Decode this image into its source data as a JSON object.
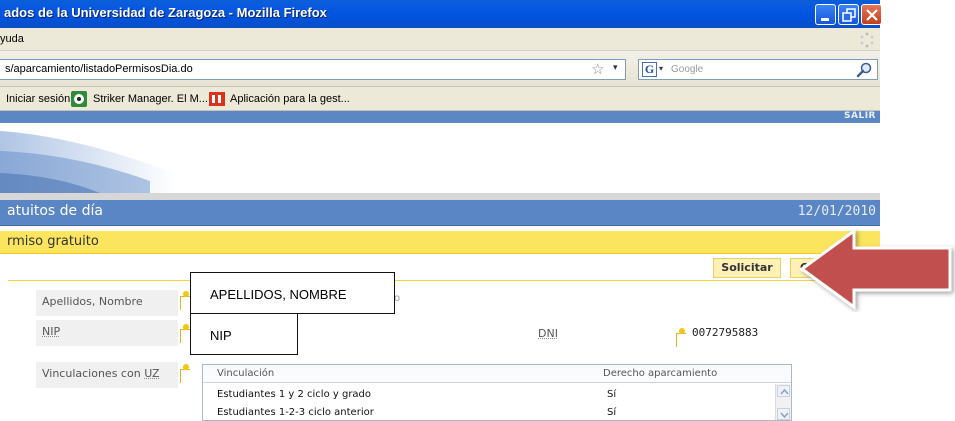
{
  "browser": {
    "window_title": "ados de la Universidad de Zaragoza - Mozilla Firefox",
    "menu_label": "yuda",
    "url": "s/aparcamiento/listadoPermisosDia.do",
    "search_engine": "G",
    "search_placeholder": "Google",
    "bookmarks": [
      {
        "label": "Iniciar sesión",
        "icon": "none"
      },
      {
        "label": "Striker Manager. El M...",
        "icon": "soccer-ball-icon"
      },
      {
        "label": "Aplicación para la gest...",
        "icon": "app-logo-icon"
      }
    ]
  },
  "header": {
    "logout_label": "SALIR"
  },
  "page": {
    "title": "atuitos de día",
    "date": "12/01/2010",
    "section_title": "rmiso gratuito"
  },
  "actions": {
    "solicitar_label": "Solicitar",
    "cancelar_label": "Ca"
  },
  "form": {
    "name_label": "Apellidos, Nombre",
    "name_overlay": "APELLIDOS, NOMBRE",
    "name_value_fragment": "o",
    "nip_label": "NIP",
    "nip_overlay": "NIP",
    "dni_label": "DNI",
    "dni_value": "0072795883",
    "vinculaciones_label_prefix": "Vinculaciones con ",
    "vinculaciones_label_abbr": "UZ"
  },
  "vinculaciones_table": {
    "columns": [
      "Vinculación",
      "Derecho aparcamiento"
    ],
    "rows": [
      [
        "Estudiantes 1 y 2 ciclo y grado",
        "Sí"
      ],
      [
        "Estudiantes 1-2-3 ciclo anterior",
        "Sí"
      ]
    ]
  },
  "colors": {
    "header_blue": "#5a86c5",
    "section_yellow": "#fbe45e",
    "arrow_red": "#c0504d"
  }
}
